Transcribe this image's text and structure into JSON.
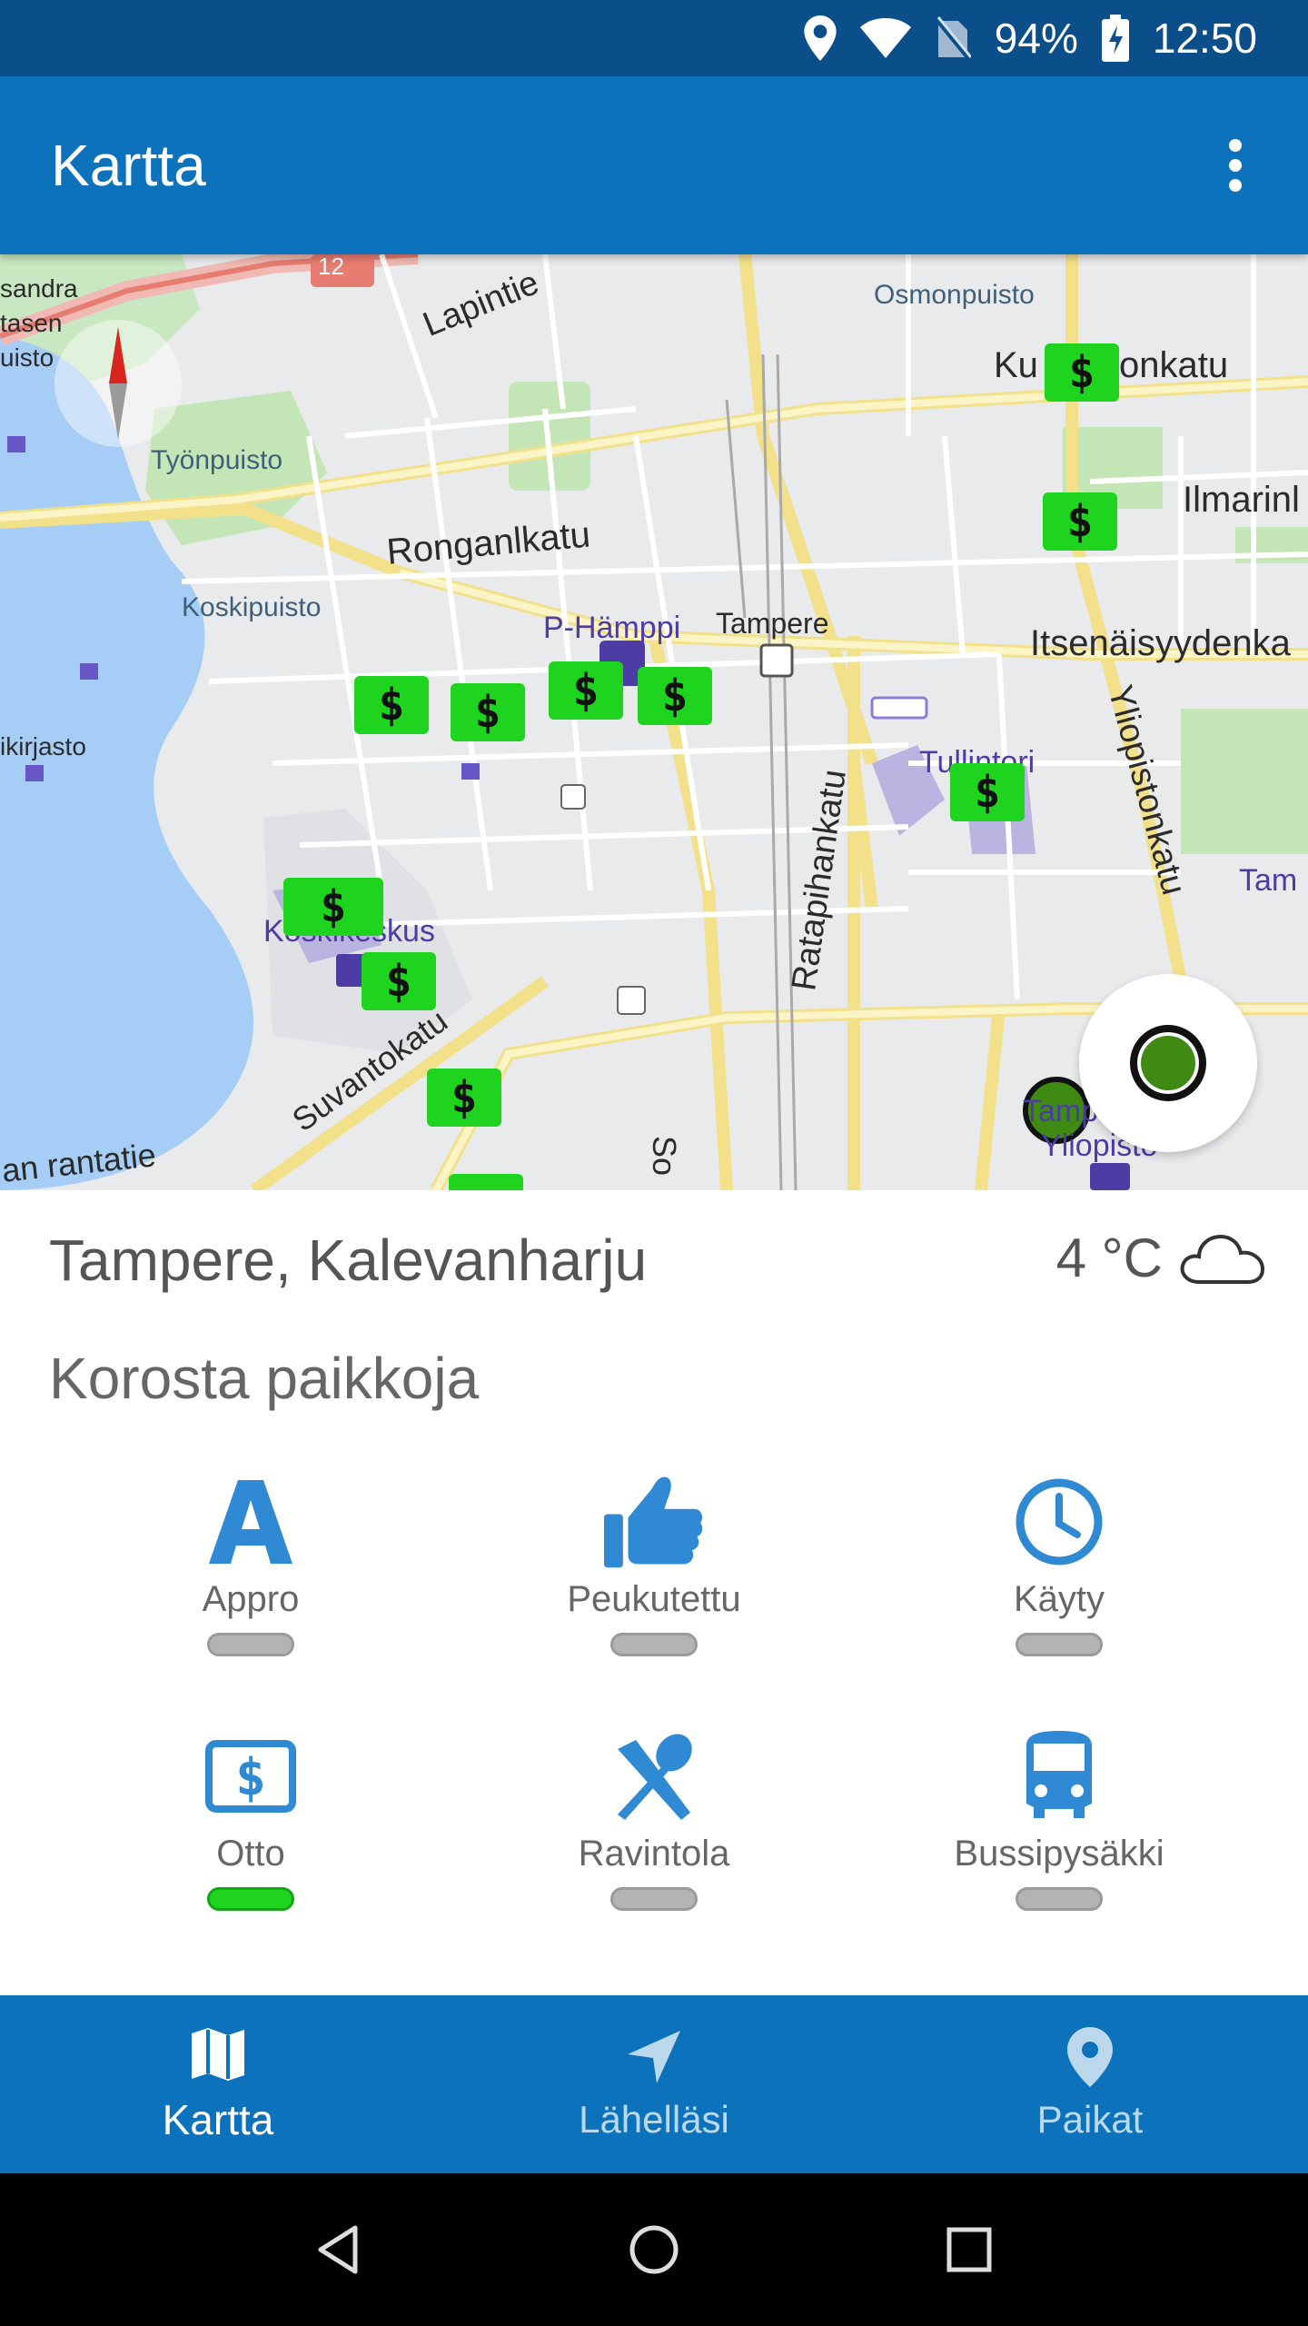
{
  "status_bar": {
    "battery": "94%",
    "time": "12:50",
    "icons": [
      "location-icon",
      "wifi-icon",
      "no-sim-icon",
      "battery-charging-icon"
    ]
  },
  "app_bar": {
    "title": "Kartta",
    "overflow_icon": "more-vert-icon"
  },
  "map": {
    "labels": {
      "sandra": "sandra",
      "tasen": "tasen",
      "uisto": "uisto",
      "lapintie": "Lapintie",
      "road_12": "12",
      "osmonpuisto": "Osmonpuisto",
      "kuninkaankatu_a": "Ku",
      "kuninkaankatu_b": "onkatu",
      "tyonpuisto": "Työnpuisto",
      "ilmarin": "Ilmarinl",
      "ronganlkatu": "Ronganlkatu",
      "koskipuisto": "Koskipuisto",
      "p_hamppi": "P-Hämppi",
      "tampere": "Tampere",
      "itsenaisyydenk": "Itsenäisyydenka",
      "ikirjasto": "ikirjasto",
      "tullintori": "Tullintori",
      "ratapihankatu": "Ratapihankatu",
      "yliopistonkatu": "Yliopistonkatu",
      "tam": "Tam",
      "koskikeskus": "Koskikeskus",
      "suvantokatu": "Suvantokatu",
      "rantatie": "an  rantatie",
      "so": "So",
      "tamp": "Tamp",
      "yliopisto": "Yliopisto"
    },
    "pin_glyph": "$",
    "pin_color": "#1ed41e",
    "location_fab_icon": "my-location-icon",
    "compass_icon": "compass-icon"
  },
  "info": {
    "location": "Tampere, Kalevanharju",
    "temperature": "4 °C",
    "weather_icon": "cloud-icon"
  },
  "highlight": {
    "title": "Korosta paikkoja",
    "items": [
      {
        "label": "Appro",
        "icon": "appro-a-icon",
        "enabled": false
      },
      {
        "label": "Peukutettu",
        "icon": "thumbs-up-icon",
        "enabled": false
      },
      {
        "label": "Käyty",
        "icon": "clock-icon",
        "enabled": false
      },
      {
        "label": "Otto",
        "icon": "atm-dollar-icon",
        "enabled": true
      },
      {
        "label": "Ravintola",
        "icon": "restaurant-icon",
        "enabled": false
      },
      {
        "label": "Bussipysäkki",
        "icon": "bus-icon",
        "enabled": false
      }
    ]
  },
  "bottom_nav": {
    "items": [
      {
        "label": "Kartta",
        "icon": "map-icon",
        "active": true
      },
      {
        "label": "Lähelläsi",
        "icon": "navigation-arrow-icon",
        "active": false
      },
      {
        "label": "Paikat",
        "icon": "place-pin-icon",
        "active": false
      }
    ]
  },
  "system_nav": [
    "back-icon",
    "home-icon",
    "recents-icon"
  ],
  "colors": {
    "primary": "#0c72bb",
    "status_bar": "#0a4e8a",
    "icon_blue": "#2f8ad3",
    "toggle_on": "#1ed41e",
    "toggle_off": "#b3b3b3"
  }
}
